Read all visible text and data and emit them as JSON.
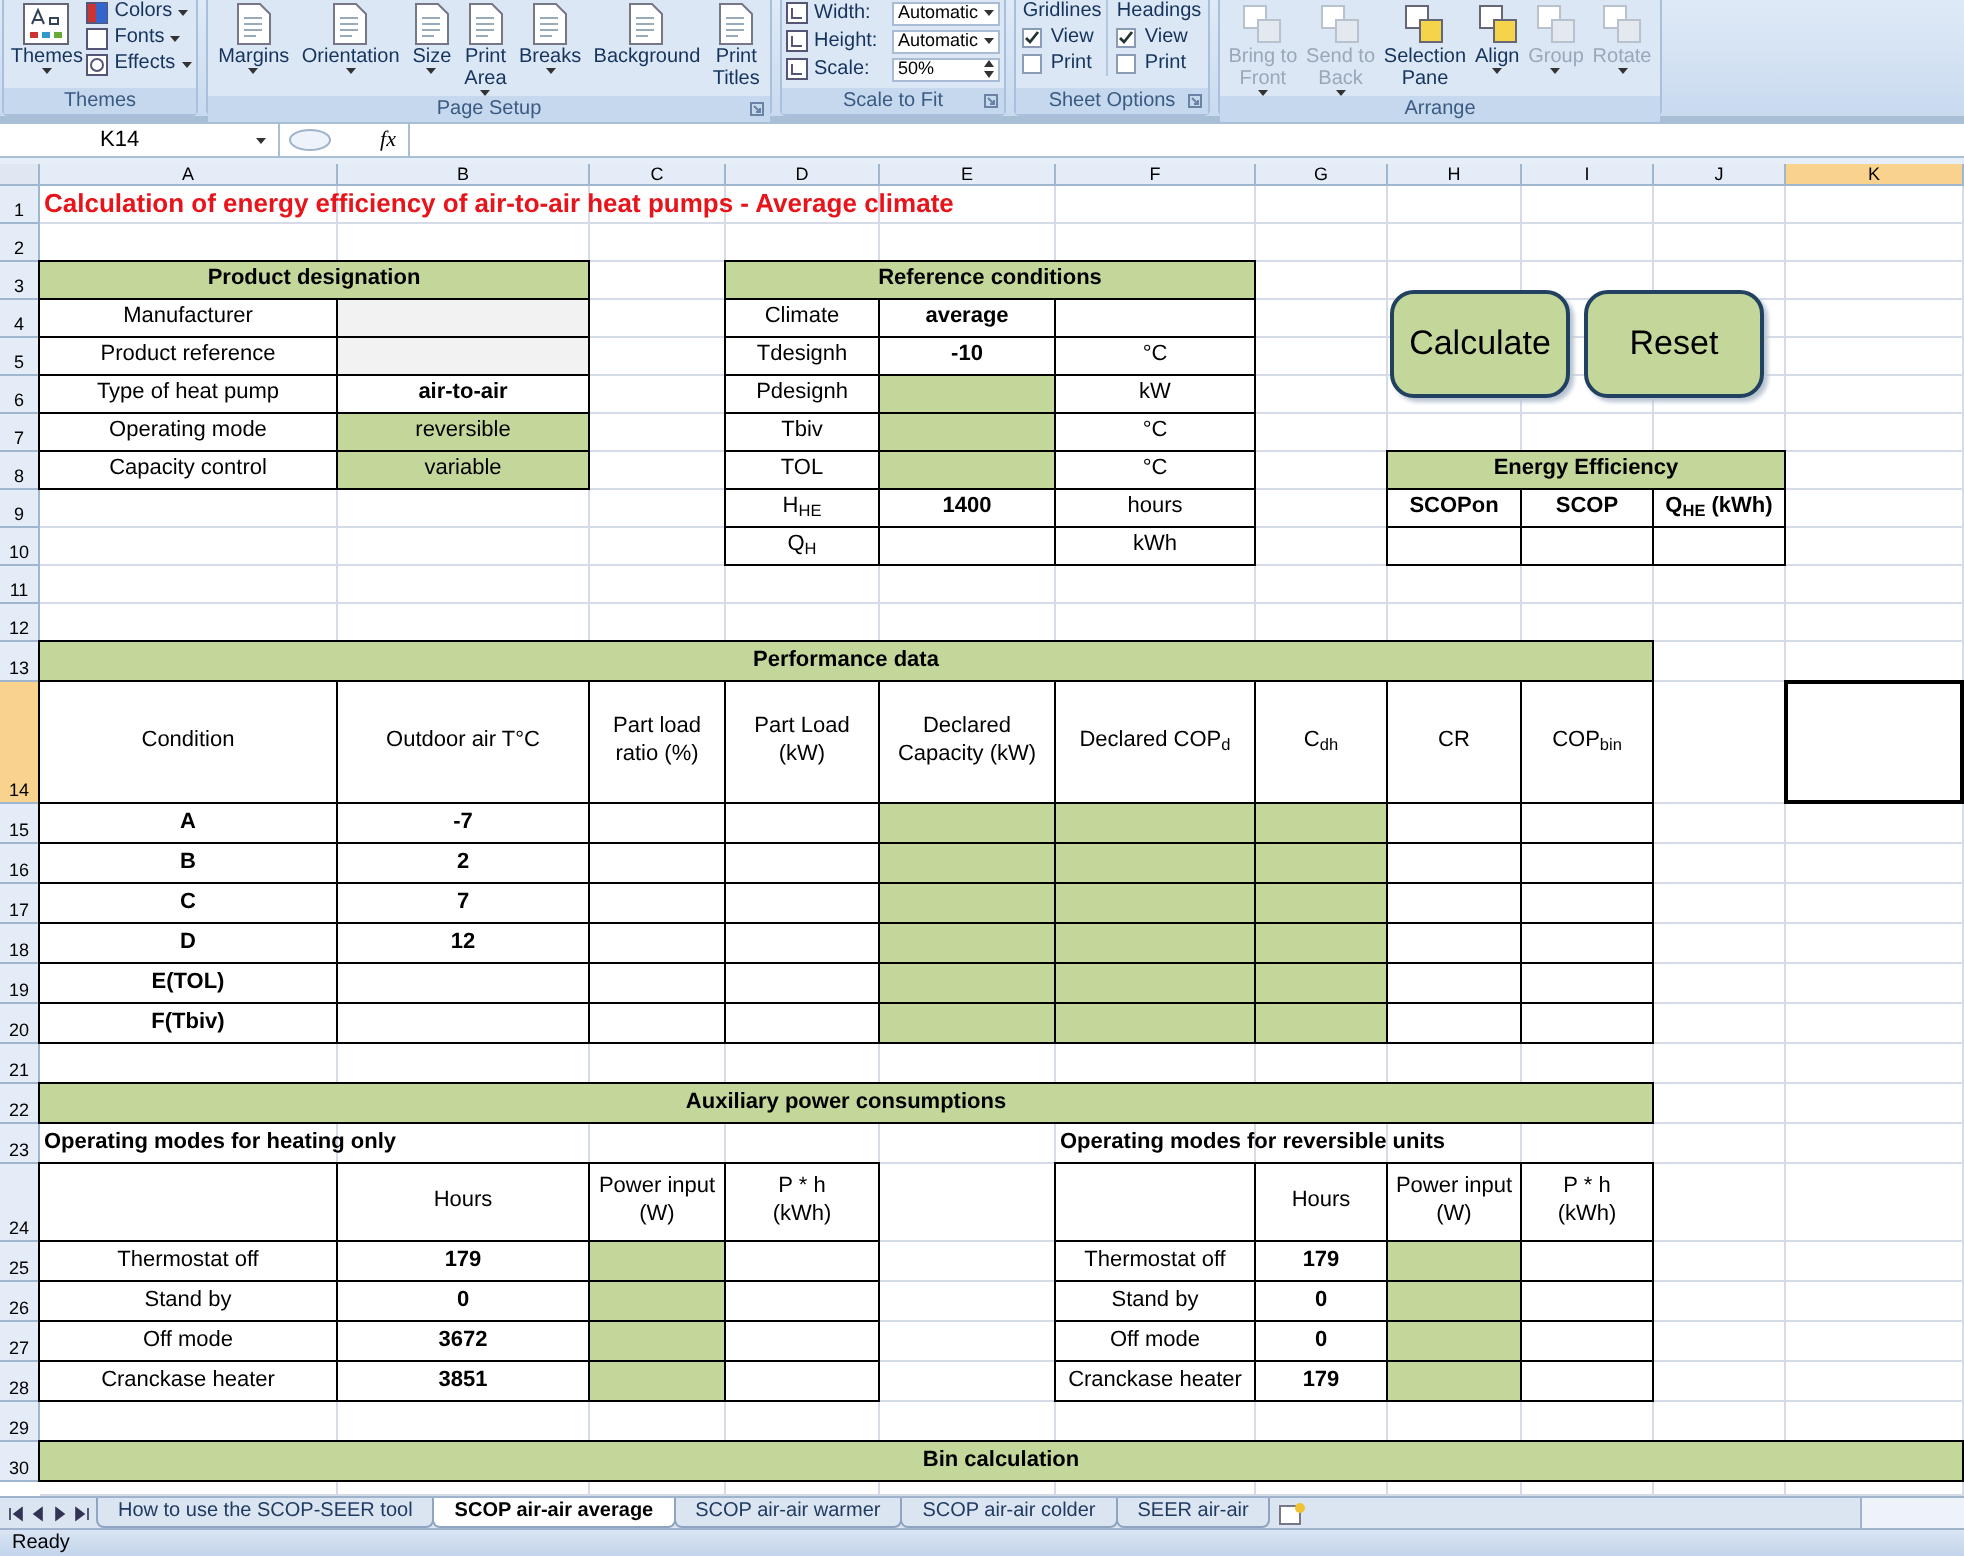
{
  "ribbon": {
    "groups": [
      {
        "label": "Themes",
        "launcher": false,
        "items": [
          {
            "kind": "large",
            "label": "Themes",
            "dropdown": true
          },
          {
            "kind": "small",
            "label": "Colors",
            "dropdown": true
          },
          {
            "kind": "small",
            "label": "Fonts",
            "dropdown": true
          },
          {
            "kind": "small",
            "label": "Effects",
            "dropdown": true
          }
        ]
      },
      {
        "label": "Page Setup",
        "launcher": true,
        "items": [
          {
            "kind": "large",
            "label": "Margins",
            "dropdown": true
          },
          {
            "kind": "large",
            "label": "Orientation",
            "dropdown": true
          },
          {
            "kind": "large",
            "label": "Size",
            "dropdown": true
          },
          {
            "kind": "large",
            "label": "Print\nArea",
            "dropdown": true
          },
          {
            "kind": "large",
            "label": "Breaks",
            "dropdown": true
          },
          {
            "kind": "large",
            "label": "Background",
            "dropdown": false
          },
          {
            "kind": "large",
            "label": "Print\nTitles",
            "dropdown": false
          }
        ]
      },
      {
        "label": "Scale to Fit",
        "launcher": true,
        "items": [
          {
            "kind": "field",
            "label": "Width:",
            "value": "Automatic",
            "spinner": false
          },
          {
            "kind": "field",
            "label": "Height:",
            "value": "Automatic",
            "spinner": false
          },
          {
            "kind": "field",
            "label": "Scale:",
            "value": "50%",
            "spinner": true
          }
        ]
      },
      {
        "label": "Sheet Options",
        "launcher": true,
        "items": [
          {
            "kind": "options",
            "title": "Gridlines",
            "checks": [
              {
                "label": "View",
                "checked": true
              },
              {
                "label": "Print",
                "checked": false
              }
            ]
          },
          {
            "kind": "options",
            "title": "Headings",
            "checks": [
              {
                "label": "View",
                "checked": true
              },
              {
                "label": "Print",
                "checked": false
              }
            ]
          }
        ]
      },
      {
        "label": "Arrange",
        "launcher": false,
        "items": [
          {
            "kind": "large",
            "label": "Bring to\nFront",
            "dropdown": true,
            "disabled": true
          },
          {
            "kind": "large",
            "label": "Send to\nBack",
            "dropdown": true,
            "disabled": true
          },
          {
            "kind": "large",
            "label": "Selection\nPane",
            "dropdown": false,
            "disabled": false
          },
          {
            "kind": "large",
            "label": "Align",
            "dropdown": true,
            "disabled": false
          },
          {
            "kind": "large",
            "label": "Group",
            "dropdown": true,
            "disabled": true
          },
          {
            "kind": "large",
            "label": "Rotate",
            "dropdown": true,
            "disabled": true
          }
        ]
      }
    ]
  },
  "formula_bar": {
    "name_box": "K14",
    "function_button": "fx"
  },
  "sheet": {
    "column_headers": [
      {
        "label": "A",
        "selected": false
      },
      {
        "label": "B",
        "selected": false
      },
      {
        "label": "C",
        "selected": false
      },
      {
        "label": "D",
        "selected": false
      },
      {
        "label": "E",
        "selected": false
      },
      {
        "label": "F",
        "selected": false
      },
      {
        "label": "G",
        "selected": false
      },
      {
        "label": "H",
        "selected": false
      },
      {
        "label": "I",
        "selected": false
      },
      {
        "label": "J",
        "selected": false
      },
      {
        "label": "K",
        "selected": true
      }
    ],
    "row_headers": [
      {
        "label": "1",
        "selected": false
      },
      {
        "label": "2",
        "selected": false
      },
      {
        "label": "3",
        "selected": false
      },
      {
        "label": "4",
        "selected": false
      },
      {
        "label": "5",
        "selected": false
      },
      {
        "label": "6",
        "selected": false
      },
      {
        "label": "7",
        "selected": false
      },
      {
        "label": "8",
        "selected": false
      },
      {
        "label": "9",
        "selected": false
      },
      {
        "label": "10",
        "selected": false
      },
      {
        "label": "11",
        "selected": false
      },
      {
        "label": "12",
        "selected": false
      },
      {
        "label": "13",
        "selected": false
      },
      {
        "label": "14",
        "selected": true
      },
      {
        "label": "15",
        "selected": false
      },
      {
        "label": "16",
        "selected": false
      },
      {
        "label": "17",
        "selected": false
      },
      {
        "label": "18",
        "selected": false
      },
      {
        "label": "19",
        "selected": false
      },
      {
        "label": "20",
        "selected": false
      },
      {
        "label": "21",
        "selected": false
      },
      {
        "label": "22",
        "selected": false
      },
      {
        "label": "23",
        "selected": false
      },
      {
        "label": "24",
        "selected": false
      },
      {
        "label": "25",
        "selected": false
      },
      {
        "label": "26",
        "selected": false
      },
      {
        "label": "27",
        "selected": false
      },
      {
        "label": "28",
        "selected": false
      },
      {
        "label": "29",
        "selected": false
      },
      {
        "label": "30",
        "selected": false
      }
    ],
    "title": "Calculation of energy efficiency of air-to-air heat pumps - Average climate",
    "product_designation": {
      "header": "Product designation",
      "rows": [
        {
          "label": "Manufacturer",
          "kind": "gray"
        },
        {
          "label": "Product reference",
          "kind": "gray"
        },
        {
          "label": "Type of heat pump",
          "value": "air-to-air",
          "kind": "fixed"
        },
        {
          "label": "Operating mode",
          "value": "reversible",
          "kind": "input"
        },
        {
          "label": "Capacity control",
          "value": "variable",
          "kind": "input"
        }
      ]
    },
    "reference_conditions": {
      "header": "Reference conditions",
      "rows": [
        {
          "label": "Climate",
          "value": "average",
          "kind": "fixed"
        },
        {
          "label": "Tdesignh",
          "value": "-10",
          "unit": "°C",
          "kind": "fixed"
        },
        {
          "label": "Pdesignh",
          "unit": "kW",
          "kind": "input"
        },
        {
          "label": "Tbiv",
          "unit": "°C",
          "kind": "input"
        },
        {
          "label": "TOL",
          "unit": "°C",
          "kind": "input"
        },
        {
          "label": "H$_{HE}$",
          "value": "1400",
          "unit": "hours",
          "kind": "fixed"
        },
        {
          "label": "Q$_{H}$",
          "unit": "kWh",
          "kind": "output"
        }
      ]
    },
    "buttons": [
      "Calculate",
      "Reset"
    ],
    "energy_efficiency": {
      "header": "Energy Efficiency",
      "columns": [
        "SCOPon",
        "SCOP",
        "Q$_{HE}$ (kWh)"
      ]
    },
    "performance_data": {
      "header": "Performance data",
      "columns": [
        {
          "label": "Condition",
          "kind": "label"
        },
        {
          "label": "Outdoor air T°C",
          "kind": "fixed"
        },
        {
          "label": "Part load\nratio (%)",
          "kind": "output"
        },
        {
          "label": "Part Load\n(kW)",
          "kind": "output"
        },
        {
          "label": "Declared\nCapacity (kW)",
          "kind": "input"
        },
        {
          "label": "Declared COP$_{d}$",
          "kind": "input"
        },
        {
          "label": "C$_{dh}$",
          "kind": "input"
        },
        {
          "label": "CR",
          "kind": "output"
        },
        {
          "label": "COP$_{bin}$",
          "kind": "output"
        }
      ],
      "rows": [
        {
          "condition": "A",
          "outdoor_temp": "-7"
        },
        {
          "condition": "B",
          "outdoor_temp": "2"
        },
        {
          "condition": "C",
          "outdoor_temp": "7"
        },
        {
          "condition": "D",
          "outdoor_temp": "12"
        },
        {
          "condition": "E(TOL)"
        },
        {
          "condition": "F(Tbiv)"
        }
      ]
    },
    "auxiliary_power": {
      "header": "Auxiliary power consumptions",
      "tables": [
        {
          "title": "Operating modes for heating only",
          "columns": [
            "Hours",
            "Power input\n(W)",
            "P * h\n(kWh)"
          ],
          "rows": [
            {
              "label": "Thermostat off",
              "hours": "179"
            },
            {
              "label": "Stand by",
              "hours": "0"
            },
            {
              "label": "Off mode",
              "hours": "3672"
            },
            {
              "label": "Cranckase heater",
              "hours": "3851"
            }
          ]
        },
        {
          "title": "Operating modes for reversible units",
          "columns": [
            "Hours",
            "Power input\n(W)",
            "P * h\n(kWh)"
          ],
          "rows": [
            {
              "label": "Thermostat off",
              "hours": "179"
            },
            {
              "label": "Stand by",
              "hours": "0"
            },
            {
              "label": "Off mode",
              "hours": "0"
            },
            {
              "label": "Cranckase heater",
              "hours": "179"
            }
          ]
        }
      ]
    },
    "bin_calculation": {
      "header": "Bin calculation"
    }
  },
  "sheet_tabs": [
    {
      "label": "How to use the SCOP-SEER tool",
      "selected": false
    },
    {
      "label": "SCOP air-air average",
      "selected": true
    },
    {
      "label": "SCOP air-air warmer",
      "selected": false
    },
    {
      "label": "SCOP air-air colder",
      "selected": false
    },
    {
      "label": "SEER air-air",
      "selected": false
    }
  ],
  "status_bar": {
    "text": "Ready"
  }
}
